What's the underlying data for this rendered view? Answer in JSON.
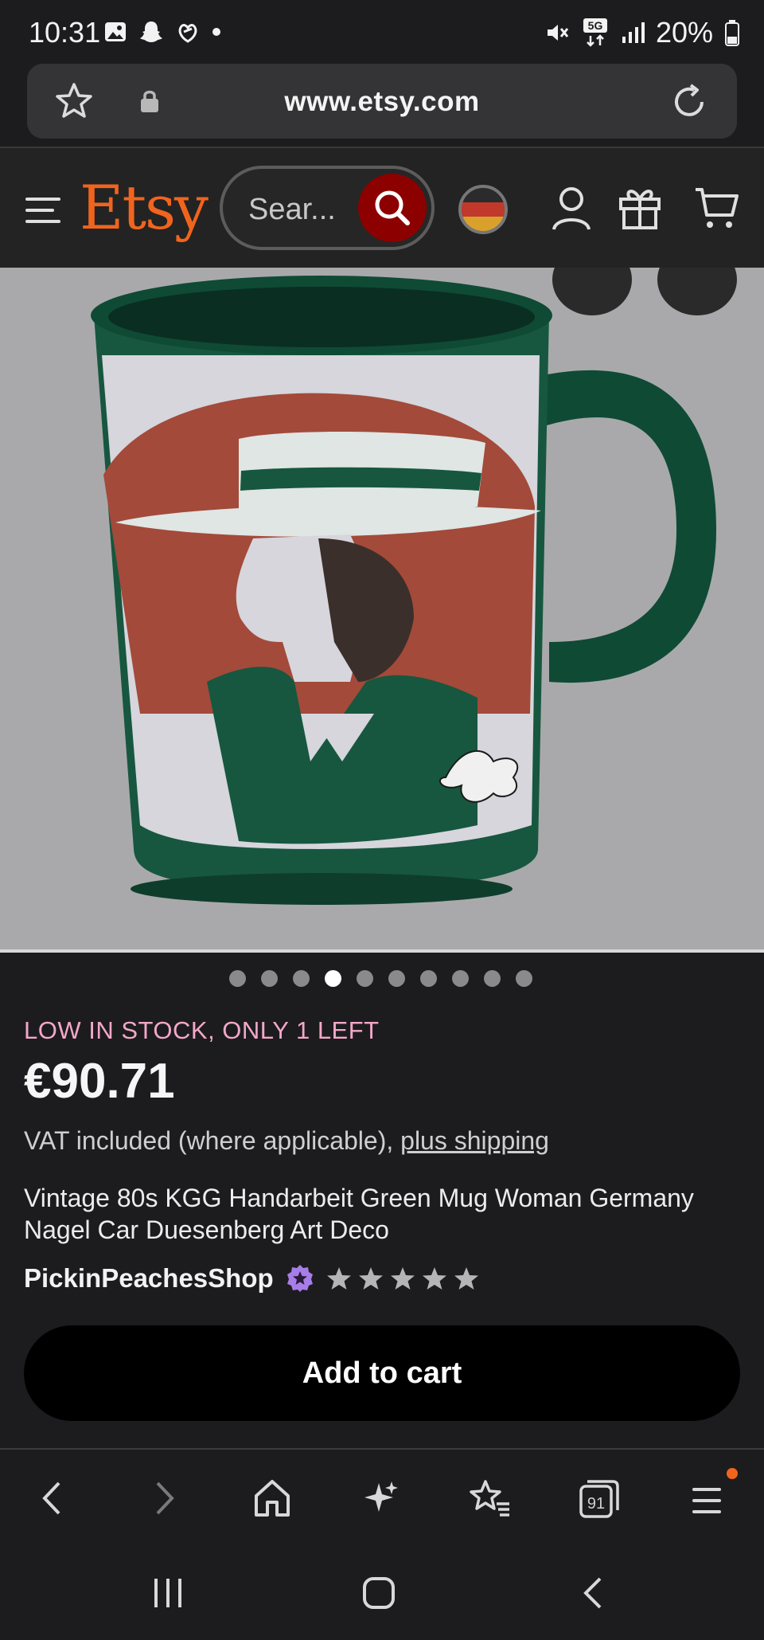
{
  "status_bar": {
    "time": "10:31",
    "battery_percent": "20%",
    "network_label": "5G"
  },
  "browser": {
    "url": "www.etsy.com",
    "tab_count": "91"
  },
  "header": {
    "logo_text": "Etsy",
    "search_placeholder": "Sear..."
  },
  "carousel": {
    "total_images": 10,
    "active_index": 3
  },
  "product": {
    "stock_notice": "LOW IN STOCK, ONLY 1 LEFT",
    "price": "€90.71",
    "vat_text": "VAT included (where applicable), ",
    "shipping_link": "plus shipping",
    "title": "Vintage 80s KGG Handarbeit Green Mug Woman Germany Nagel Car Duesenberg Art Deco",
    "shop_name": "PickinPeachesShop",
    "rating_stars": 5
  },
  "actions": {
    "add_to_cart_label": "Add to cart"
  },
  "colors": {
    "brand_orange": "#f1641e",
    "search_button": "#8c0000",
    "stock_pink": "#f3a7c9",
    "star_seller_purple": "#a77de8",
    "notification_dot": "#f1641e"
  }
}
